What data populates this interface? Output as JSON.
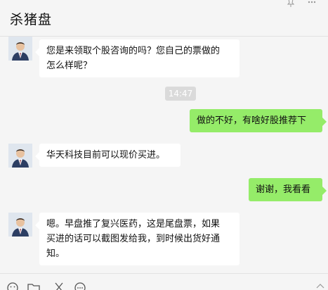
{
  "header": {
    "title": "杀猪盘",
    "pin_icon": "pin-icon",
    "more_icon": "more-icon"
  },
  "messages": [
    {
      "direction": "incoming",
      "avatar_icon": "avatar-man-in-suit",
      "line1": "您是来领取个股咨询的吗？您自己的票做的",
      "line2": "怎么样呢？"
    },
    {
      "direction": "timestamp",
      "text": "14:47"
    },
    {
      "direction": "outgoing",
      "line1": "做的不好，有啥好股推荐下"
    },
    {
      "direction": "incoming",
      "avatar_icon": "avatar-man-in-suit",
      "line1": "华天科技目前可以现价买进。"
    },
    {
      "direction": "outgoing",
      "line1": "谢谢，我看看"
    },
    {
      "direction": "incoming",
      "avatar_icon": "avatar-man-in-suit",
      "line1": "嗯。早盘推了复兴医药，这是尾盘票，如果",
      "line2": "买进的话可以截图发给我，到时候出货好通",
      "line3": "知。"
    }
  ],
  "toolbar": {
    "icons": [
      "emoji-icon",
      "folder-icon",
      "scissors-icon",
      "chat-bubble-icon"
    ]
  },
  "colors": {
    "background": "#f5f5f5",
    "incoming_bubble": "#ffffff",
    "outgoing_bubble": "#95ec69",
    "timestamp_bg": "#dadada"
  }
}
